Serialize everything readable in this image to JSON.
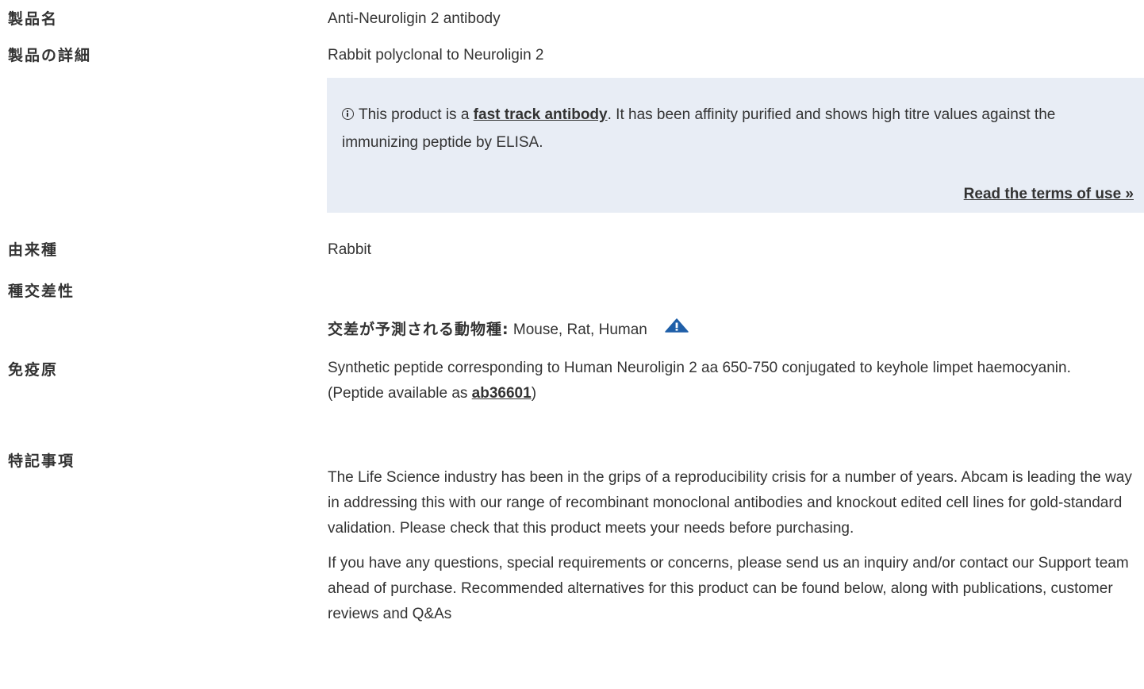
{
  "rows": {
    "product_name": {
      "label": "製品名",
      "value": "Anti-Neuroligin 2 antibody"
    },
    "product_detail": {
      "label": "製品の詳細",
      "value": "Rabbit polyclonal to Neuroligin 2"
    },
    "notice": {
      "text_before": "This product is a ",
      "link": "fast track antibody",
      "text_after": ". It has been affinity purified and shows high titre values against the immunizing peptide by ELISA.",
      "terms_link": "Read the terms of use »"
    },
    "host": {
      "label": "由来種",
      "value": "Rabbit"
    },
    "reactivity": {
      "label": "種交差性",
      "predicted_label": "交差が予測される動物種:",
      "predicted_value": " Mouse, Rat, Human",
      "icon": "warning-triangle-icon"
    },
    "immunogen": {
      "label": "免疫原",
      "line1": "Synthetic peptide corresponding to Human Neuroligin 2 aa 650-750 conjugated to keyhole limpet haemocyanin.",
      "peptide_before": "(Peptide available as ",
      "peptide_link": "ab36601",
      "peptide_after": ")"
    },
    "notes": {
      "label": "特記事項",
      "para1": "The Life Science industry has been in the grips of a reproducibility crisis for a number of years. Abcam is leading the way in addressing this with our range of recombinant monoclonal antibodies and knockout edited cell lines for gold-standard validation. Please check that this product meets your needs before purchasing.",
      "para2": "If you have any questions, special requirements or concerns, please send us an inquiry and/or contact our Support team ahead of purchase. Recommended alternatives for this product can be found below, along with publications, customer reviews and Q&As"
    }
  },
  "colors": {
    "text": "#333333",
    "notice_bg": "#e8edf5",
    "warning_icon": "#1f5fa8"
  }
}
